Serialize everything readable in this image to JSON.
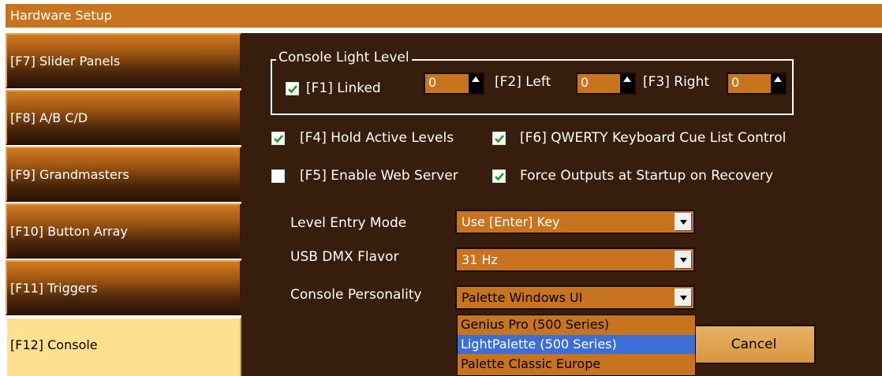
{
  "window": {
    "title": "Hardware Setup"
  },
  "nav": {
    "items": [
      {
        "label": "[F7] Slider Panels"
      },
      {
        "label": "[F8] A/B C/D"
      },
      {
        "label": "[F9] Grandmasters"
      },
      {
        "label": "[F10] Button Array"
      },
      {
        "label": "[F11] Triggers"
      },
      {
        "label": "[F12] Console",
        "active": true
      }
    ]
  },
  "light_level": {
    "group_title": "Console Light Level",
    "linked": {
      "label": "[F1] Linked",
      "checked": true,
      "value": "0"
    },
    "left": {
      "label": "[F2] Left",
      "value": "0"
    },
    "right": {
      "label": "[F3] Right",
      "value": "0"
    }
  },
  "options": {
    "hold_active_levels": {
      "label": "[F4] Hold Active Levels",
      "checked": true
    },
    "qwerty_cue_control": {
      "label": "[F6] QWERTY Keyboard Cue List Control",
      "checked": true
    },
    "enable_web_server": {
      "label": "[F5] Enable Web Server",
      "checked": false
    },
    "force_outputs": {
      "label": "Force Outputs at Startup on Recovery",
      "checked": true
    }
  },
  "settings": {
    "level_entry_mode": {
      "label": "Level Entry Mode",
      "value": "Use [Enter] Key"
    },
    "usb_dmx_flavor": {
      "label": "USB DMX Flavor",
      "value": "31 Hz"
    },
    "console_personality": {
      "label": "Console Personality",
      "value": "Palette Windows UI",
      "options": [
        "Genius Pro (500 Series)",
        "LightPalette (500 Series)",
        "Palette Classic Europe"
      ],
      "highlighted_option": "LightPalette (500 Series)"
    }
  },
  "buttons": {
    "cancel": "Cancel"
  },
  "colors": {
    "accent_orange": "#c8731e",
    "panel_brown": "#371d0b",
    "active_tab": "#ffdf90",
    "selection_blue": "#3b6ed6"
  }
}
